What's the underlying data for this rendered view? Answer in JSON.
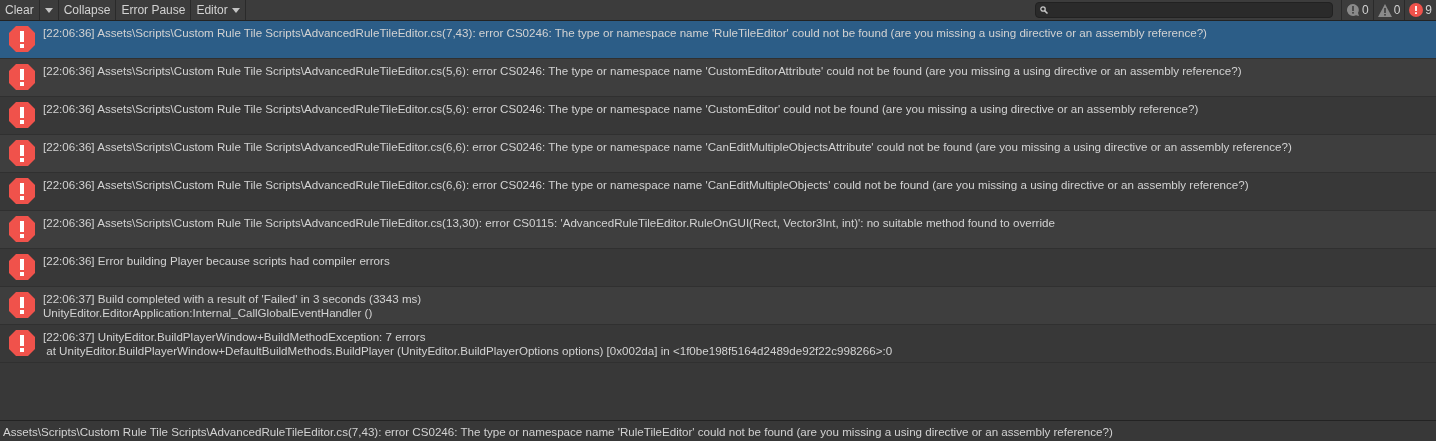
{
  "toolbar": {
    "buttons": [
      {
        "label": "Clear",
        "kind": "split"
      },
      {
        "label": "Collapse",
        "kind": "plain"
      },
      {
        "label": "Error Pause",
        "kind": "plain"
      },
      {
        "label": "Editor",
        "kind": "dropdown"
      }
    ],
    "counters": [
      {
        "kind": "info",
        "count": "0"
      },
      {
        "kind": "warning",
        "count": "0"
      },
      {
        "kind": "error",
        "count": "9"
      }
    ]
  },
  "log": [
    {
      "selected": true,
      "lines": [
        "[22:06:36] Assets\\Scripts\\Custom Rule Tile Scripts\\AdvancedRuleTileEditor.cs(7,43): error CS0246: The type or namespace name 'RuleTileEditor' could not be found (are you missing a using directive or an assembly reference?)"
      ]
    },
    {
      "selected": false,
      "lines": [
        "[22:06:36] Assets\\Scripts\\Custom Rule Tile Scripts\\AdvancedRuleTileEditor.cs(5,6): error CS0246: The type or namespace name 'CustomEditorAttribute' could not be found (are you missing a using directive or an assembly reference?)"
      ]
    },
    {
      "selected": false,
      "lines": [
        "[22:06:36] Assets\\Scripts\\Custom Rule Tile Scripts\\AdvancedRuleTileEditor.cs(5,6): error CS0246: The type or namespace name 'CustomEditor' could not be found (are you missing a using directive or an assembly reference?)"
      ]
    },
    {
      "selected": false,
      "lines": [
        "[22:06:36] Assets\\Scripts\\Custom Rule Tile Scripts\\AdvancedRuleTileEditor.cs(6,6): error CS0246: The type or namespace name 'CanEditMultipleObjectsAttribute' could not be found (are you missing a using directive or an assembly reference?)"
      ]
    },
    {
      "selected": false,
      "lines": [
        "[22:06:36] Assets\\Scripts\\Custom Rule Tile Scripts\\AdvancedRuleTileEditor.cs(6,6): error CS0246: The type or namespace name 'CanEditMultipleObjects' could not be found (are you missing a using directive or an assembly reference?)"
      ]
    },
    {
      "selected": false,
      "lines": [
        "[22:06:36] Assets\\Scripts\\Custom Rule Tile Scripts\\AdvancedRuleTileEditor.cs(13,30): error CS0115: 'AdvancedRuleTileEditor.RuleOnGUI(Rect, Vector3Int, int)': no suitable method found to override"
      ]
    },
    {
      "selected": false,
      "lines": [
        "[22:06:36] Error building Player because scripts had compiler errors"
      ]
    },
    {
      "selected": false,
      "lines": [
        "[22:06:37] Build completed with a result of 'Failed' in 3 seconds (3343 ms)",
        "UnityEditor.EditorApplication:Internal_CallGlobalEventHandler ()"
      ]
    },
    {
      "selected": false,
      "lines": [
        "[22:06:37] UnityEditor.BuildPlayerWindow+BuildMethodException: 7 errors",
        " at UnityEditor.BuildPlayerWindow+DefaultBuildMethods.BuildPlayer (UnityEditor.BuildPlayerOptions options) [0x002da] in <1f0be198f5164d2489de92f22c998266>:0"
      ]
    }
  ],
  "status_bar": {
    "message": "Assets\\Scripts\\Custom Rule Tile Scripts\\AdvancedRuleTileEditor.cs(7,43): error CS0246: The type or namespace name 'RuleTileEditor' could not be found (are you missing a using directive or an assembly reference?)"
  }
}
